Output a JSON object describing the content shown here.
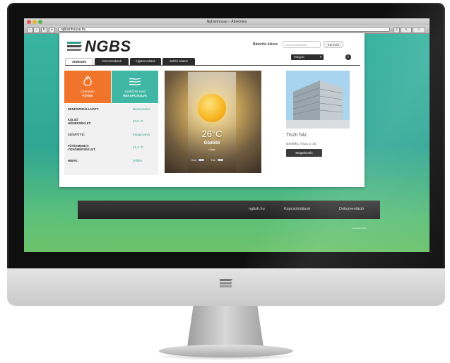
{
  "browser": {
    "window_title": "Ngbsinhouse – Áttekintés",
    "url": "ngbsinhouse.hu"
  },
  "header": {
    "logo_text": "NGBS",
    "search_label": "Bátorító élésre",
    "search_placeholder": "Keresés/keresés",
    "search_button": "Keresés",
    "language_select": "Magyar",
    "info_icon": "info-icon"
  },
  "tabs": [
    {
      "label": "Áttekintés",
      "active": true
    },
    {
      "label": "Szenzoradatok",
      "active": false
    },
    {
      "label": "Irigátos adatok",
      "active": false
    },
    {
      "label": "Beltéri adatok",
      "active": false
    }
  ],
  "tiles": {
    "gas": {
      "line1": "Üzemben",
      "line2": "FÜTÉS",
      "icon": "flame-icon"
    },
    "air": {
      "line1": "Szellőzős mód",
      "line2": "RÉKAPCSOLVA",
      "icon": "wind-icon"
    }
  },
  "status": [
    {
      "key": "RENDSZERÁLLAPOT:",
      "value": "Beüzemelve"
    },
    {
      "key": "KÜLSŐ HŐMÉRSÉKLET:",
      "value": "23.9 °C"
    },
    {
      "key": "SZIVATTYÚ:",
      "value": "Kikapcsolva"
    },
    {
      "key": "FŰTÉSMENETI VÍZHŐMÉRSÉKLET:",
      "value": "21.3 °C"
    },
    {
      "key": "HIBÁK:",
      "value": "Telítés"
    }
  ],
  "weather": {
    "temperature": "26°C",
    "city": "Gödöllő",
    "condition": "Clear",
    "forecast": [
      {
        "day": "Sun",
        "icon": "cloud-icon"
      },
      {
        "day": "Tue",
        "icon": "cloud-icon"
      }
    ]
  },
  "building": {
    "title": "Tiszti ház",
    "address": "Gödöllő, Tisza u. 10.",
    "button": "Megtekintés"
  },
  "footer": {
    "links": [
      "ngbsh.hu",
      "Kapcsolódások",
      "Dokumentáció"
    ],
    "copyright": "Copyright 2013"
  }
}
